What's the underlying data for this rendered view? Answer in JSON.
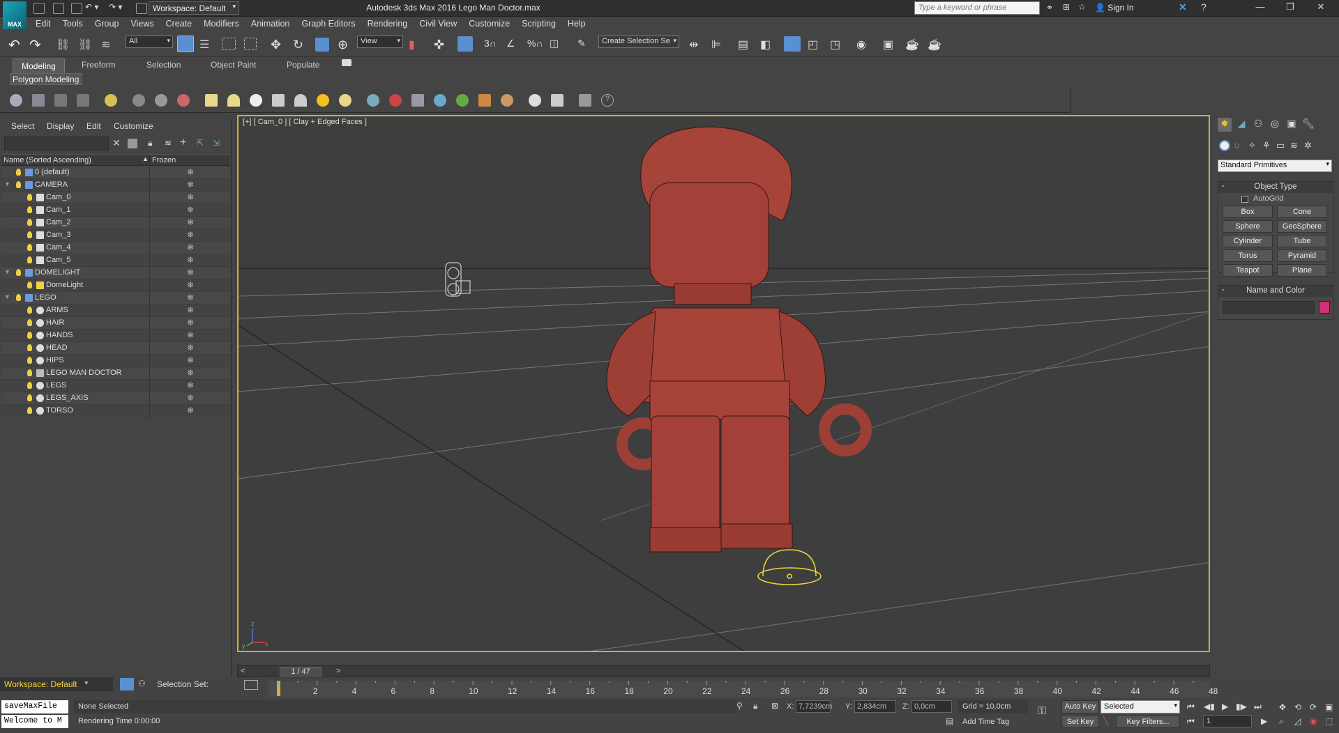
{
  "titlebar": {
    "workspace": "Workspace: Default",
    "title": "Autodesk 3ds Max 2016     Lego Man Doctor.max",
    "search_placeholder": "Type a keyword or phrase",
    "sign_in": "Sign In",
    "logo": "MAX"
  },
  "menu": [
    "Edit",
    "Tools",
    "Group",
    "Views",
    "Create",
    "Modifiers",
    "Animation",
    "Graph Editors",
    "Rendering",
    "Civil View",
    "Customize",
    "Scripting",
    "Help"
  ],
  "toolbar": {
    "selection_filter": "All",
    "ref_coord": "View",
    "selection_set": "Create Selection Se",
    "snap_3": "3",
    "percent": "%"
  },
  "ribbon": {
    "tabs": [
      "Modeling",
      "Freeform",
      "Selection",
      "Object Paint",
      "Populate"
    ],
    "panel": "Polygon Modeling"
  },
  "explorer": {
    "menu": [
      "Select",
      "Display",
      "Edit",
      "Customize"
    ],
    "col_name": "Name (Sorted Ascending)",
    "col_frozen": "Frozen",
    "rows": [
      {
        "label": "0 (default)",
        "indent": 0,
        "type": "layer"
      },
      {
        "label": "CAMERA",
        "indent": 0,
        "type": "layer",
        "expand": true
      },
      {
        "label": "Cam_0",
        "indent": 1,
        "type": "camera"
      },
      {
        "label": "Cam_1",
        "indent": 1,
        "type": "camera"
      },
      {
        "label": "Cam_2",
        "indent": 1,
        "type": "camera"
      },
      {
        "label": "Cam_3",
        "indent": 1,
        "type": "camera"
      },
      {
        "label": "Cam_4",
        "indent": 1,
        "type": "camera"
      },
      {
        "label": "Cam_5",
        "indent": 1,
        "type": "camera"
      },
      {
        "label": "DOMELIGHT",
        "indent": 0,
        "type": "layer",
        "expand": true
      },
      {
        "label": "DomeLight",
        "indent": 1,
        "type": "light"
      },
      {
        "label": "LEGO",
        "indent": 0,
        "type": "layer",
        "expand": true
      },
      {
        "label": "ARMS",
        "indent": 1,
        "type": "object"
      },
      {
        "label": "HAIR",
        "indent": 1,
        "type": "object"
      },
      {
        "label": "HANDS",
        "indent": 1,
        "type": "object"
      },
      {
        "label": "HEAD",
        "indent": 1,
        "type": "object"
      },
      {
        "label": "HIPS",
        "indent": 1,
        "type": "object"
      },
      {
        "label": "LEGO MAN DOCTOR",
        "indent": 1,
        "type": "group"
      },
      {
        "label": "LEGS",
        "indent": 1,
        "type": "object"
      },
      {
        "label": "LEGS_AXIS",
        "indent": 1,
        "type": "object"
      },
      {
        "label": "TORSO",
        "indent": 1,
        "type": "object"
      }
    ],
    "frozen_glyph": "❄"
  },
  "viewport": {
    "label": "[+] [ Cam_0 ] [ Clay + Edged Faces ]",
    "axis_y": "y",
    "axis_x": "x",
    "axis_z": "z"
  },
  "command_panel": {
    "dropdown": "Standard Primitives",
    "object_type_title": "Object Type",
    "autogrid": "AutoGrid",
    "buttons": [
      "Box",
      "Cone",
      "Sphere",
      "GeoSphere",
      "Cylinder",
      "Tube",
      "Torus",
      "Pyramid",
      "Teapot",
      "Plane"
    ],
    "name_color_title": "Name and Color",
    "object_color": "#d2307a"
  },
  "timeline": {
    "frame_label": "1 / 47",
    "prev": "<",
    "next": ">",
    "ticks": [
      "2",
      "4",
      "6",
      "8",
      "10",
      "12",
      "14",
      "16",
      "18",
      "20",
      "22",
      "24",
      "26",
      "28",
      "30",
      "32",
      "34",
      "36",
      "38",
      "40",
      "42",
      "44",
      "46",
      "48"
    ]
  },
  "status": {
    "workspace": "Workspace: Default",
    "selection_set": "Selection Set:",
    "maxscript_1": "saveMaxFile",
    "maxscript_2": "Welcome to M",
    "none_selected": "None Selected",
    "rendering_time": "Rendering Time  0:00:00",
    "x_label": "X:",
    "x_value": "7,7239cm",
    "y_label": "Y:",
    "y_value": "2,834cm",
    "z_label": "Z:",
    "z_value": "0,0cm",
    "grid": "Grid = 10,0cm",
    "add_time_tag": "Add Time Tag",
    "auto_key": "Auto Key",
    "set_key": "Set Key",
    "selected_dd": "Selected",
    "key_filters": "Key Filters...",
    "frame": "1"
  }
}
